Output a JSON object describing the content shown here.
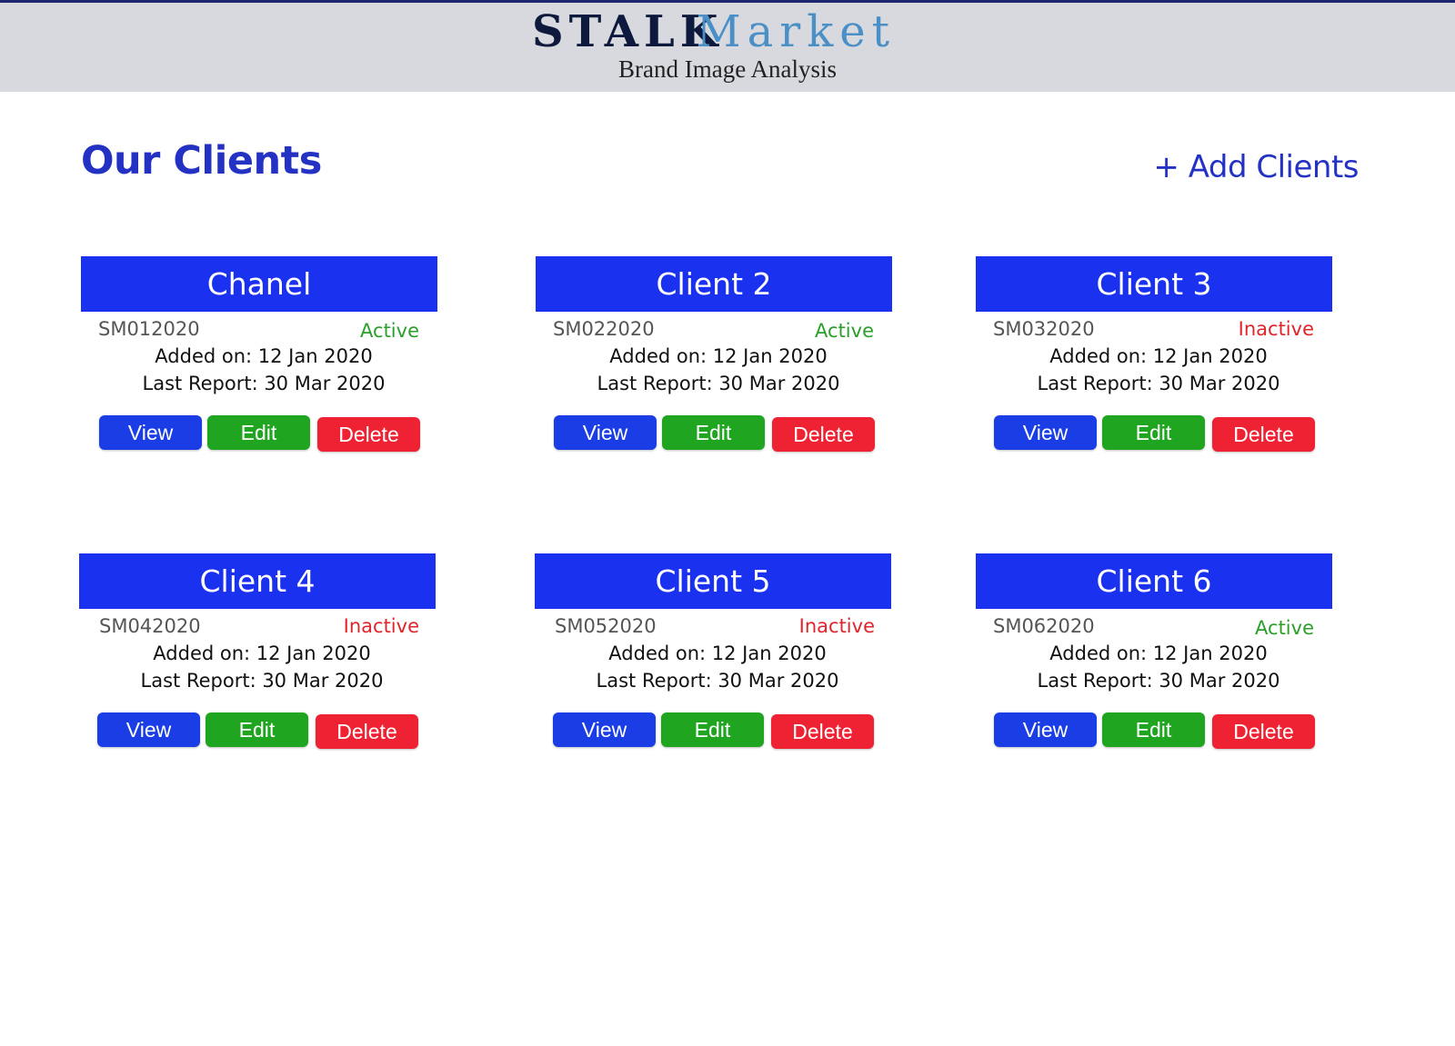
{
  "brand": {
    "name_part1": "STALK",
    "name_part2": "Market",
    "tagline": "Brand Image Analysis"
  },
  "page_title": "Our Clients",
  "add_clients_label": "+ Add Clients",
  "buttons": {
    "view": "View",
    "edit": "Edit",
    "delete": "Delete"
  },
  "labels": {
    "added_prefix": "Added on: ",
    "report_prefix": "Last Report: "
  },
  "colors": {
    "header_bg": "#d8d9de",
    "card_header": "#1a32f0",
    "title_blue": "#2432c4",
    "active": "#2aa02a",
    "inactive": "#e0242c",
    "view_button": "#1a3de6",
    "edit_button": "#1fa51f",
    "delete_button": "#ee2233"
  },
  "clients": [
    {
      "name": "Chanel",
      "id": "SM012020",
      "status": "Active",
      "added_text": "Added on: 12 Jan 2020",
      "report_text": "Last Report: 30 Mar 2020"
    },
    {
      "name": "Client 2",
      "id": "SM022020",
      "status": "Active",
      "added_text": "Added on: 12 Jan 2020",
      "report_text": "Last Report: 30 Mar 2020"
    },
    {
      "name": "Client 3",
      "id": "SM032020",
      "status": "Inactive",
      "added_text": "Added on: 12 Jan 2020",
      "report_text": "Last Report: 30 Mar 2020"
    },
    {
      "name": "Client 4",
      "id": "SM042020",
      "status": "Inactive",
      "added_text": "Added on: 12 Jan 2020",
      "report_text": "Last Report: 30 Mar 2020"
    },
    {
      "name": "Client 5",
      "id": "SM052020",
      "status": "Inactive",
      "added_text": "Added on: 12 Jan 2020",
      "report_text": "Last Report: 30 Mar 2020"
    },
    {
      "name": "Client 6",
      "id": "SM062020",
      "status": "Active",
      "added_text": "Added on: 12 Jan 2020",
      "report_text": "Last Report: 30 Mar 2020"
    }
  ]
}
